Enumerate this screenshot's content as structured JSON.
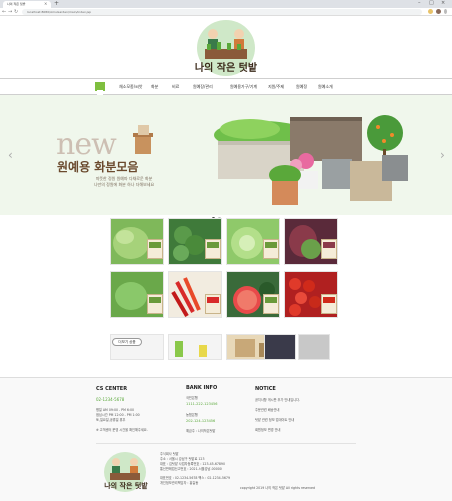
{
  "browser": {
    "tab_title": "나의 작은 텃밭",
    "url": "localhost:8080/AmuGarden/main/index.jsp",
    "new_tab_symbol": "+",
    "tab_close_symbol": "×",
    "min_symbol": "–",
    "max_symbol": "□",
    "close_symbol": "×",
    "back_symbol": "←",
    "forward_symbol": "→",
    "reload_symbol": "↻"
  },
  "brand": {
    "name": "나의 작은 텃밭"
  },
  "nav": {
    "items": [
      "채소모종/씨앗",
      "화분",
      "비료",
      "원예장/관리",
      "원예용가구/기계",
      "지원/주제",
      "원예정",
      "원예소개"
    ]
  },
  "banner": {
    "new_word": "new",
    "title": "원예용 화분모음",
    "subtitle_line1": "따뜻한 정원 원예파 다채로운 화분",
    "subtitle_line2": "나만의 정원에 화분 하나 더해보세요",
    "prev_arrow": "‹",
    "next_arrow": "›"
  },
  "products": {
    "view_more": "더보기 상품"
  },
  "footer": {
    "cs": {
      "title": "CS CENTER",
      "phone": "02-1234-5678",
      "hours1": "평일 AM 09:00 - PM 6:00",
      "hours2": "점심시간 PM 12:00 - PM 1:00",
      "hours3": "토,일요일,공휴일 휴무",
      "note": "※ 고객센터 운영 시간을 확인해주세요."
    },
    "bank": {
      "title": "BANK INFO",
      "bank1": "국민은행",
      "acct1": "1111-222-123456",
      "bank2": "농협은행",
      "acct2": "202-124-123456",
      "holder": "예금주 : 나의작은텃밭"
    },
    "notice": {
      "title": "NOTICE",
      "items": [
        "공지사항 게시판 추가 안내입니다.",
        "주문관련 배송안내",
        "텃밭 관련 정보 업데이트 안내",
        "회원정보 변경 안내"
      ]
    },
    "company": {
      "line1": "주식회사 텃밭",
      "line2": "주소 : 서울시 강남구 텃밭로 123",
      "line3": "대표 : 김텃밭  사업자등록번호 : 123-45-67890",
      "line4": "통신판매업신고번호 : 2021-서울강남-00000",
      "line5": "대표번호 : 02-1234-5678   팩스 : 02-1234-5679",
      "line6": "개인정보관리책임자 : 홍길동",
      "copyright": "copyright 2019 나의 작은 텃밭 All rights reserved"
    }
  },
  "colors": {
    "accent": "#7fbf3f",
    "brand_brown": "#6b4a2e",
    "banner_bg": "#f0f7ec"
  }
}
